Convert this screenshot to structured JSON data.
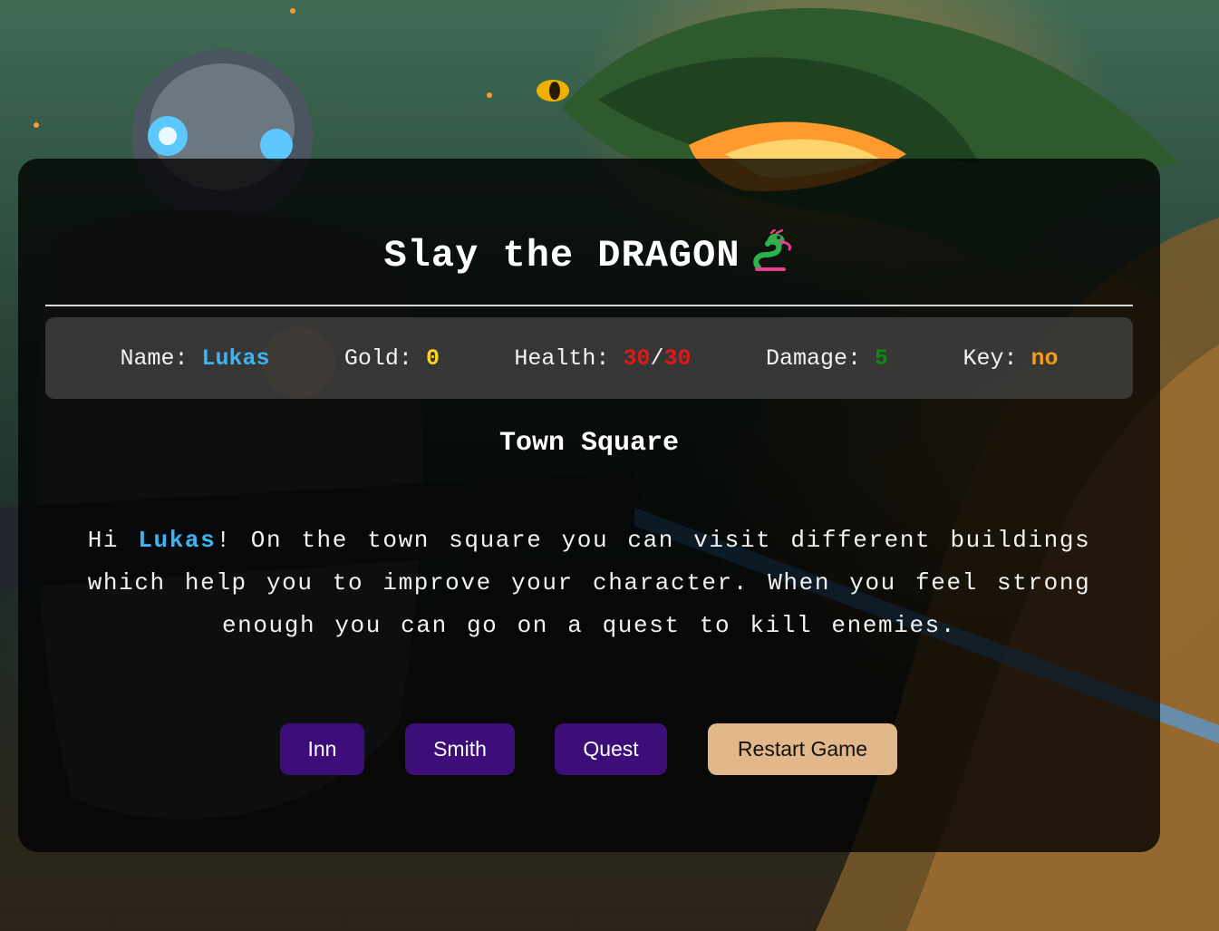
{
  "game": {
    "title": "Slay the DRAGON",
    "title_icon": "dragon-emoji-icon"
  },
  "stats": {
    "name_label": "Name:",
    "name_value": "Lukas",
    "gold_label": "Gold:",
    "gold_value": "0",
    "health_label": "Health:",
    "health_current": "30",
    "health_separator": "/",
    "health_max": "30",
    "damage_label": "Damage:",
    "damage_value": "5",
    "key_label": "Key:",
    "key_value": "no"
  },
  "location": {
    "title": "Town Square",
    "text_before": "Hi ",
    "player_name": "Lukas",
    "text_after": "! On the town square you can visit different buildings which help you to improve your character. When you feel strong enough you can go on a quest to kill enemies."
  },
  "actions": {
    "inn_label": "Inn",
    "smith_label": "Smith",
    "quest_label": "Quest",
    "restart_label": "Restart Game"
  },
  "colors": {
    "panel_background": "#000000",
    "primary_button": "#3d0e7a",
    "restart_button": "#e2b88a",
    "name_highlight": "#3db4f2",
    "gold": "#ffd21f",
    "health": "#e01818",
    "damage": "#0d8a10",
    "key": "#f29f0f"
  },
  "background": {
    "scene": "robot-and-dragon-illustration"
  }
}
